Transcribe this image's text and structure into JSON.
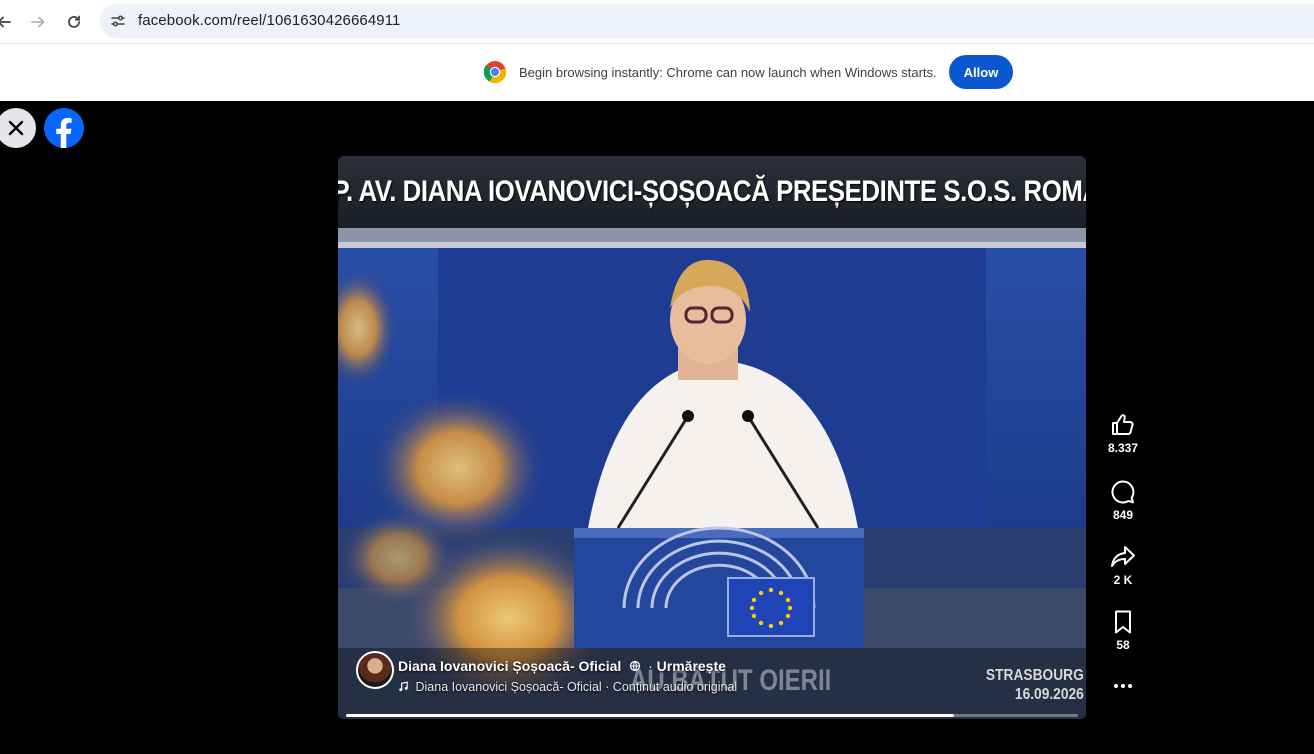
{
  "browser": {
    "url": "facebook.com/reel/1061630426664911",
    "infobar_text": "Begin browsing instantly: Chrome can now launch when Windows starts.",
    "allow_label": "Allow"
  },
  "reel": {
    "title_overlay": "M.E.P. AV. DIANA IOVANOVICI-ȘOȘOACĂ PREȘEDINTE S.O.S. ROMÂNIA",
    "watermark_text": "AU BĂTUT OIERII",
    "location_line1": "STRASBOURG",
    "location_line2": "16.09.2026",
    "author": "Diana Iovanovici Șoșoacă- Oficial",
    "separator": "·",
    "follow_label": "Urmărește",
    "audio_text": "Diana Iovanovici Șoșoacă- Oficial · Conținut audio original",
    "progress": 0.83
  },
  "actions": {
    "likes": "8.337",
    "comments": "849",
    "shares": "2 K",
    "saves": "58"
  }
}
